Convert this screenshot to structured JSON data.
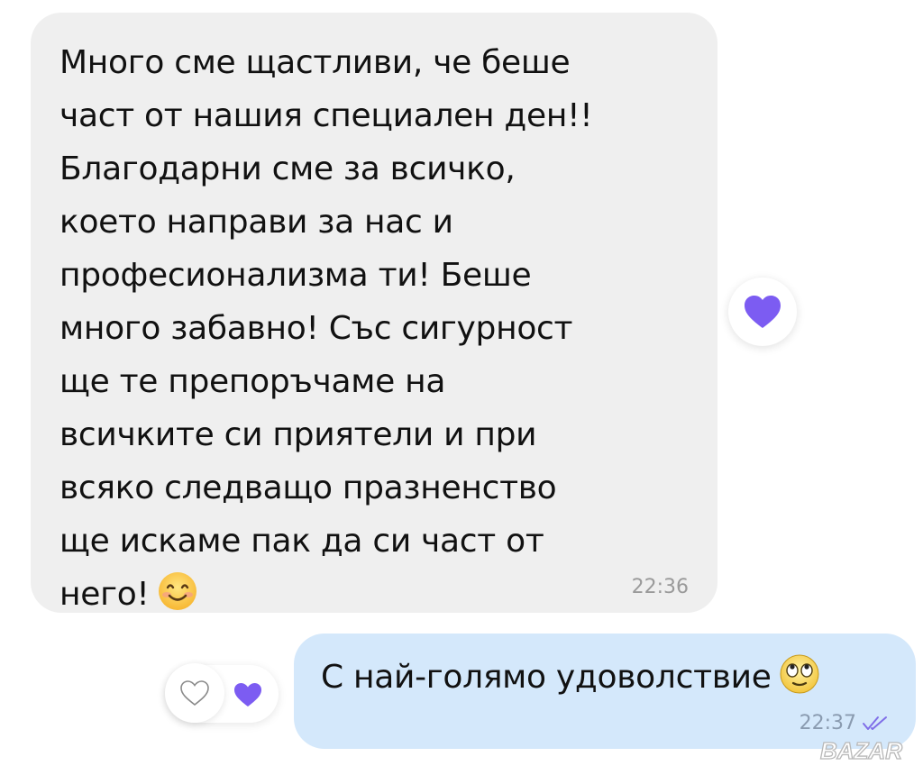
{
  "messages": [
    {
      "direction": "incoming",
      "text": "Много сме щастливи, че беше\nчаст от нашия специален ден!!\nБлагодарни сме за всичко,\nкоето направи за нас и\nпрофесионализма ти! Беше\nмного забавно! Със сигурност\nще те препоръчаме на\nвсичките си приятели и при\nвсяко следващо празненство\nще искаме пак да си част от\nнего!",
      "emoji": "smiling-face-icon",
      "time": "22:36",
      "reaction": "purple-heart-icon"
    },
    {
      "direction": "outgoing",
      "text": "С най-голямо удоволствие",
      "emoji": "rolling-eyes-face-icon",
      "time": "22:37",
      "status": "read-double-check-icon",
      "reactions": [
        "add-reaction-heart-outline-icon",
        "purple-heart-icon"
      ]
    }
  ],
  "colors": {
    "incoming_bubble": "#efefef",
    "outgoing_bubble": "#d4e8fb",
    "heart": "#7c5cf2",
    "read_check": "#7f6ee8"
  },
  "watermark": "BAZAR"
}
